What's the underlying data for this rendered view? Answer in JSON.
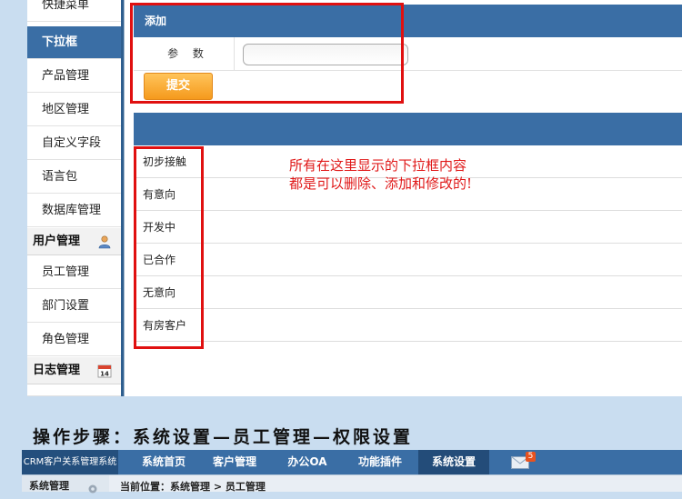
{
  "sidebar": {
    "items": [
      {
        "label": "快捷菜单"
      },
      {
        "label": "下拉框"
      },
      {
        "label": "产品管理"
      },
      {
        "label": "地区管理"
      },
      {
        "label": "自定义字段"
      },
      {
        "label": "语言包"
      },
      {
        "label": "数据库管理"
      }
    ],
    "user_group": {
      "label": "用户管理",
      "items": [
        {
          "label": "员工管理"
        },
        {
          "label": "部门设置"
        },
        {
          "label": "角色管理"
        }
      ]
    },
    "log_group": {
      "label": "日志管理",
      "icon_number": "14"
    }
  },
  "form": {
    "header": "添加",
    "param_label": "参 数",
    "param_value": "",
    "submit_label": "提交"
  },
  "dropdown_list": {
    "items": [
      "初步接触",
      "有意向",
      "开发中",
      "已合作",
      "无意向",
      "有房客户"
    ]
  },
  "annotation": {
    "line1": "所有在这里显示的下拉框内容",
    "line2": "都是可以删除、添加和修改的!"
  },
  "instruction": "操作步骤：系统设置—员工管理—权限设置",
  "crm": {
    "app_title": "CRM客户关系管理系统",
    "tabs": [
      "系统首页",
      "客户管理",
      "办公OA",
      "功能插件",
      "系统设置"
    ],
    "mail_count": "5",
    "sub_left": "系统管理",
    "location": "当前位置：系统管理 > 员工管理"
  },
  "colors": {
    "header_blue": "#3a6ea5",
    "submit_orange": "#f59a1d",
    "highlight_red": "#e01010",
    "page_bg": "#c9ddf0"
  }
}
